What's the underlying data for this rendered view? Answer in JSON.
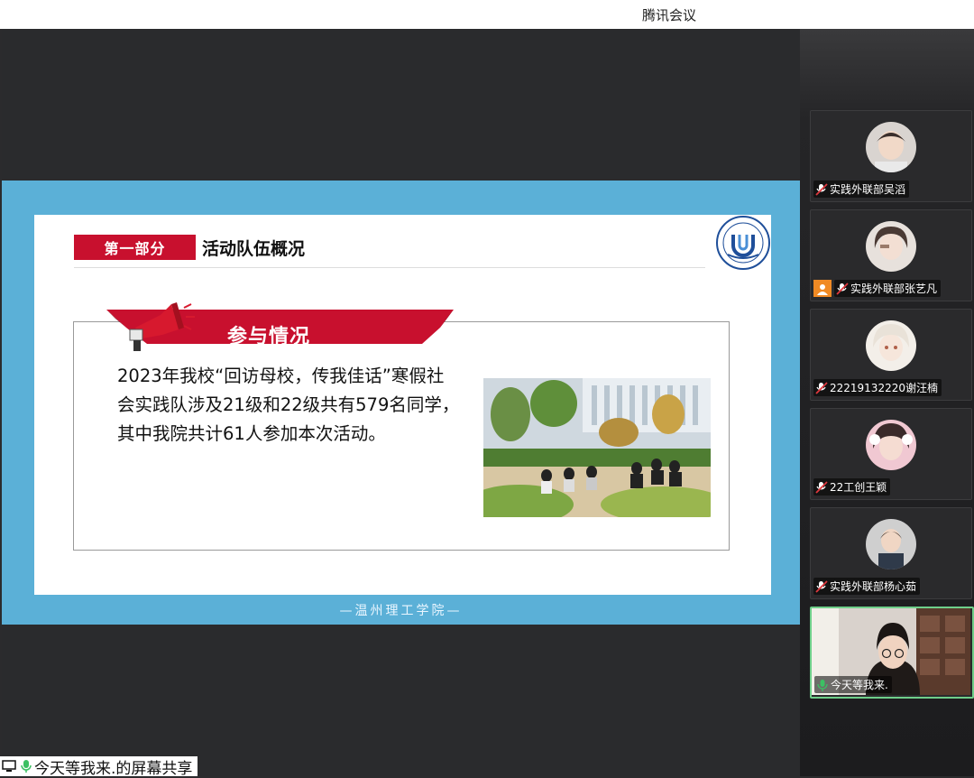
{
  "window": {
    "title": "腾讯会议"
  },
  "slide": {
    "section_badge": "第一部分",
    "section_title": "活动队伍概况",
    "banner": "参与情况",
    "body": "2023年我校“回访母校，传我佳话”寒假社会实践队涉及21级和22级共有579名同学，其中我院共计61人参加本次活动。",
    "footer": "—温州理工学院—"
  },
  "screen_share_label": "今天等我来.的屏幕共享",
  "participants": [
    {
      "name": "实践外联部吴滔",
      "mic": "mic-off-icon"
    },
    {
      "name": "实践外联部张艺凡",
      "mic": "mic-off-icon",
      "camera_badge": "person-icon"
    },
    {
      "name": "22219132220谢汪楠",
      "mic": "mic-off-icon"
    },
    {
      "name": "22工创王颖",
      "mic": "mic-off-icon"
    },
    {
      "name": "实践外联部杨心茹",
      "mic": "mic-off-icon"
    },
    {
      "name": "今天等我来.",
      "mic": "mic-on-icon",
      "active": true
    }
  ],
  "colors": {
    "slide_frame": "#5bb0d7",
    "badge_red": "#c8102e",
    "active_border": "#6fcf8a",
    "mic_on": "#3cc063"
  }
}
